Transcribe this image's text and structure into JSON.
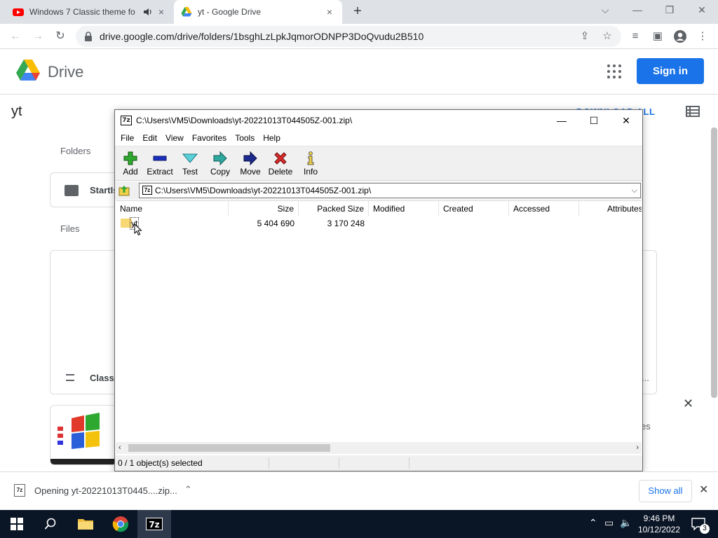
{
  "browser": {
    "tabs": [
      {
        "title": "Windows 7 Classic theme fo",
        "audio": "speaker-icon",
        "close": "×"
      },
      {
        "title": "yt - Google Drive",
        "close": "×"
      }
    ],
    "new_tab": "+",
    "url": "drive.google.com/drive/folders/1bsghLzLpkJqmorODNPP3DoQvudu2B510"
  },
  "drive": {
    "product_name": "Drive",
    "sign_in": "Sign in",
    "folder_title": "yt",
    "download_all": "DOWNLOAD ALL",
    "folders_label": "Folders",
    "folder_card_name": "StartIs",
    "files_label": "Files",
    "file_card_name": "Classi",
    "file_card_more": "...",
    "toast_text": "es"
  },
  "sevenzip": {
    "title": "C:\\Users\\VM5\\Downloads\\yt-20221013T044505Z-001.zip\\",
    "menu": [
      "File",
      "Edit",
      "View",
      "Favorites",
      "Tools",
      "Help"
    ],
    "toolbar": [
      "Add",
      "Extract",
      "Test",
      "Copy",
      "Move",
      "Delete",
      "Info"
    ],
    "path": "C:\\Users\\VM5\\Downloads\\yt-20221013T044505Z-001.zip\\",
    "columns": [
      "Name",
      "Size",
      "Packed Size",
      "Modified",
      "Created",
      "Accessed",
      "Attributes"
    ],
    "rows": [
      {
        "name": "yt",
        "size": "5 404 690",
        "packed": "3 170 248",
        "modified": "",
        "created": "",
        "accessed": "",
        "attributes": ""
      }
    ],
    "status": "0 / 1 object(s) selected"
  },
  "download_shelf": {
    "item": "Opening yt-20221013T0445....zip...",
    "show_all": "Show all"
  },
  "taskbar": {
    "time": "9:46 PM",
    "date": "10/12/2022",
    "notifications": "3"
  },
  "colors": {
    "drive_blue": "#1a73e8",
    "taskbar": "#0a1526",
    "delete_red": "#d92b2b",
    "add_green": "#2fa82f"
  }
}
